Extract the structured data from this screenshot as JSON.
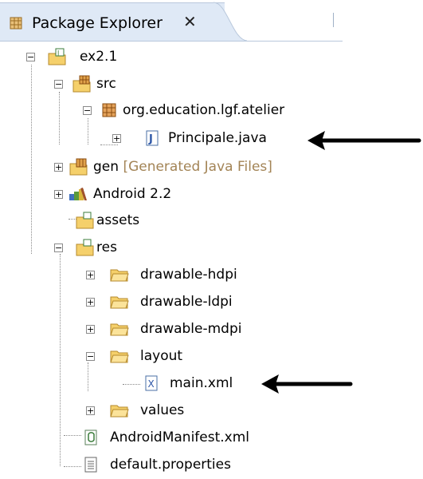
{
  "view": {
    "title": "Package Explorer",
    "close_glyph": "✕"
  },
  "tree": {
    "project": {
      "label": "ex2.1",
      "icon": "android-project-icon"
    },
    "src": {
      "label": "src",
      "icon": "source-folder-icon"
    },
    "package": {
      "label": "org.education.lgf.atelier",
      "icon": "package-icon"
    },
    "principale": {
      "label": "Principale.java",
      "icon": "java-file-icon"
    },
    "gen": {
      "label": "gen",
      "decoration": "[Generated Java Files]",
      "icon": "source-folder-icon"
    },
    "android": {
      "label": "Android 2.2",
      "icon": "library-icon"
    },
    "assets": {
      "label": "assets",
      "icon": "folder-icon"
    },
    "res": {
      "label": "res",
      "icon": "folder-icon"
    },
    "drawable_hdpi": {
      "label": "drawable-hdpi",
      "icon": "folder-icon"
    },
    "drawable_ldpi": {
      "label": "drawable-ldpi",
      "icon": "folder-icon"
    },
    "drawable_mdpi": {
      "label": "drawable-mdpi",
      "icon": "folder-icon"
    },
    "layout": {
      "label": "layout",
      "icon": "folder-icon"
    },
    "main_xml": {
      "label": "main.xml",
      "icon": "xml-file-icon"
    },
    "values": {
      "label": "values",
      "icon": "folder-icon"
    },
    "manifest": {
      "label": "AndroidManifest.xml",
      "icon": "android-manifest-icon"
    },
    "default_props": {
      "label": "default.properties",
      "icon": "text-file-icon"
    }
  },
  "expander": {
    "collapsed": "+",
    "expanded": "−"
  },
  "colors": {
    "tab_bg": "#dfe9f6",
    "folder": "#f5d06b",
    "decoration_text": "#a38456",
    "arrow": "#000000"
  }
}
